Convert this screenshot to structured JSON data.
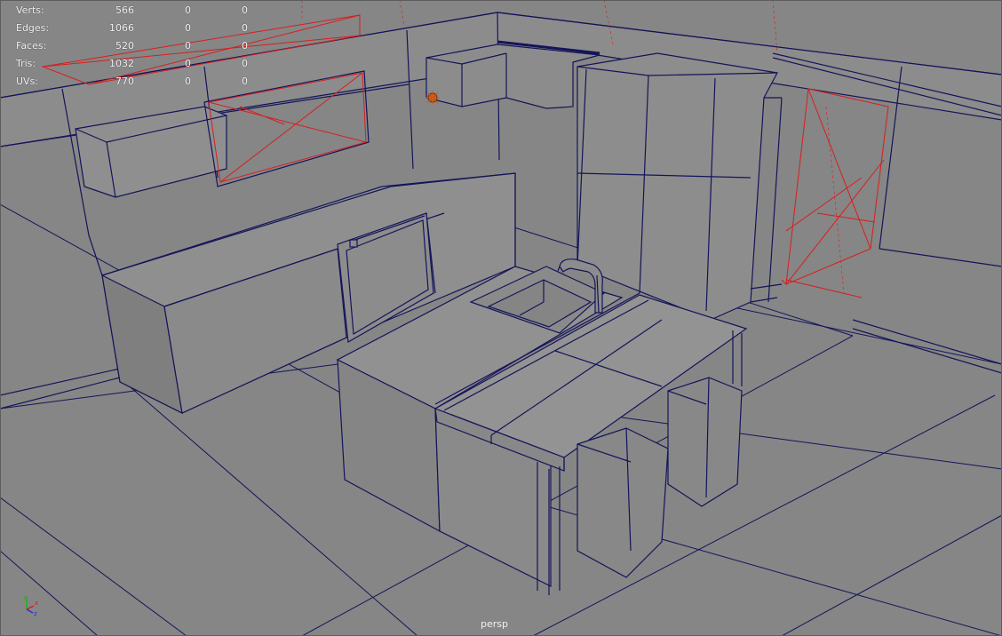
{
  "viewport": {
    "camera": "persp",
    "background_color": "#868686",
    "wire_color": "#14145a",
    "camera_wire_color": "#d81e1e",
    "light_icon": "light-icon"
  },
  "hud": {
    "rows": [
      {
        "label": "Verts:",
        "v1": "566",
        "v2": "0",
        "v3": "0"
      },
      {
        "label": "Edges:",
        "v1": "1066",
        "v2": "0",
        "v3": "0"
      },
      {
        "label": "Faces:",
        "v1": "520",
        "v2": "0",
        "v3": "0"
      },
      {
        "label": "Tris:",
        "v1": "1032",
        "v2": "0",
        "v3": "0"
      },
      {
        "label": "UVs:",
        "v1": "770",
        "v2": "0",
        "v3": "0"
      }
    ]
  },
  "axis_gizmo": {
    "icon": "axis-gizmo-icon",
    "labels": {
      "x": "x",
      "y": "y",
      "z": "z"
    },
    "colors": {
      "x": "#d02020",
      "y": "#20b020",
      "z": "#3030d0"
    }
  }
}
